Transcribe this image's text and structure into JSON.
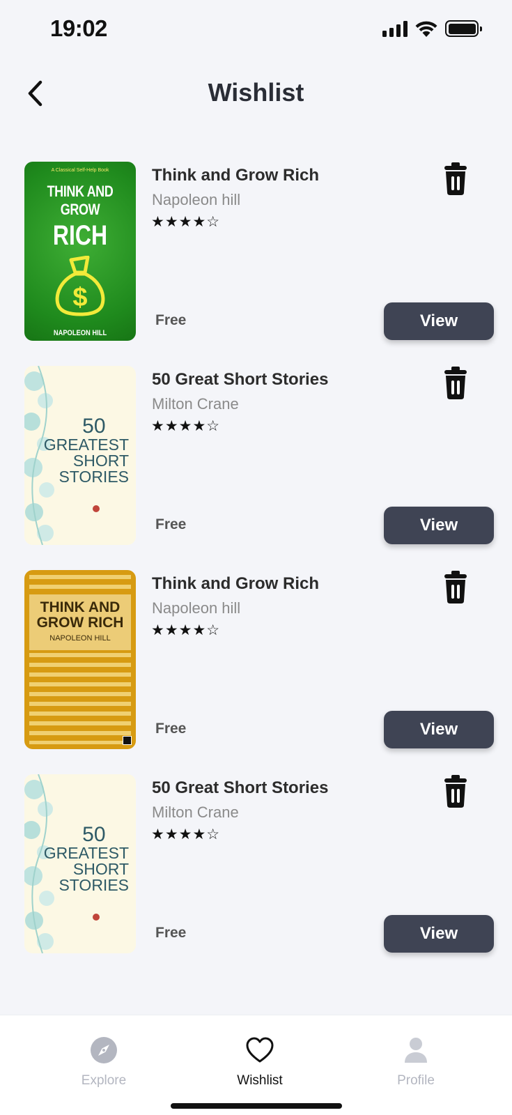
{
  "status_bar": {
    "time": "19:02"
  },
  "header": {
    "title": "Wishlist"
  },
  "items": [
    {
      "title": "Think and Grow Rich",
      "author": "Napoleon hill",
      "rating": 4,
      "stars": "★★★★☆",
      "price": "Free",
      "view_label": "View",
      "cover": {
        "style": "green",
        "tagline": "A Classical Self-Help Book",
        "line1": "THINK AND GROW",
        "line2": "RICH",
        "author": "NAPOLEON HILL"
      }
    },
    {
      "title": "50 Great Short Stories",
      "author": "Milton Crane",
      "rating": 4,
      "stars": "★★★★☆",
      "price": "Free",
      "view_label": "View",
      "cover": {
        "style": "cream",
        "line1": "50",
        "line2": "GREATEST",
        "line3": "SHORT",
        "line4": "STORIES"
      }
    },
    {
      "title": "Think and Grow Rich",
      "author": "Napoleon hill",
      "rating": 4,
      "stars": "★★★★☆",
      "price": "Free",
      "view_label": "View",
      "cover": {
        "style": "yellow",
        "line1": "THINK AND",
        "line2": "GROW RICH",
        "author": "NAPOLEON HILL"
      }
    },
    {
      "title": "50 Great Short Stories",
      "author": "Milton Crane",
      "rating": 4,
      "stars": "★★★★☆",
      "price": "Free",
      "view_label": "View",
      "cover": {
        "style": "cream",
        "line1": "50",
        "line2": "GREATEST",
        "line3": "SHORT",
        "line4": "STORIES"
      }
    }
  ],
  "tab_bar": {
    "tabs": [
      {
        "label": "Explore",
        "icon": "compass-icon",
        "active": false
      },
      {
        "label": "Wishlist",
        "icon": "heart-icon",
        "active": true
      },
      {
        "label": "Profile",
        "icon": "person-icon",
        "active": false
      }
    ]
  },
  "colors": {
    "background": "#f4f5f9",
    "button": "#3f4454",
    "inactive_tab": "#b3b6c0"
  }
}
